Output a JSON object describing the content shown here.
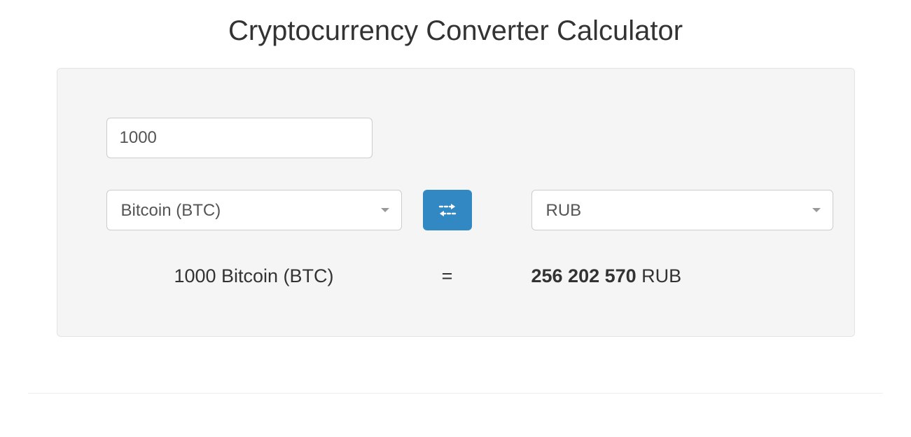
{
  "title": "Cryptocurrency Converter Calculator",
  "amount_input": {
    "value": "1000"
  },
  "from_currency": {
    "selected": "Bitcoin (BTC)"
  },
  "to_currency": {
    "selected": "RUB"
  },
  "result": {
    "from_text": "1000 Bitcoin (BTC)",
    "equals": "=",
    "to_amount": "256 202 570",
    "to_currency": "RUB"
  }
}
